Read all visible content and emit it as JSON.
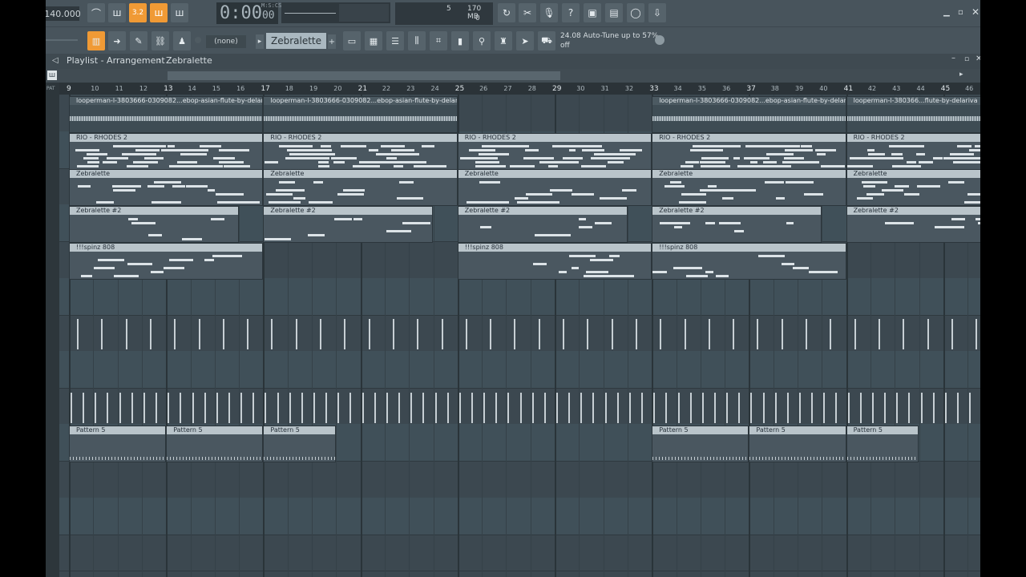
{
  "toolbar": {
    "tempo": "140.000",
    "time_main": "0:00",
    "time_cs": "00",
    "time_unit": "M:S:CS",
    "cpu_value": "5",
    "memory": "170 MB",
    "voices": "0",
    "pattern_mode_label": "3.2"
  },
  "toolbar2": {
    "none_select": "(none)",
    "pattern_select": "Zebralette",
    "hint_version": "24.08",
    "hint_text": "Auto-Tune up to 57% off"
  },
  "playlist": {
    "title": "Playlist - Arrangement",
    "breadcrumb_sep": "›",
    "pattern": "Zebralette",
    "pat_label": "PAT"
  },
  "ruler": {
    "bars": [
      "9",
      "10",
      "11",
      "12",
      "13",
      "14",
      "15",
      "16",
      "17",
      "18",
      "19",
      "20",
      "21",
      "22",
      "23",
      "24",
      "25",
      "26",
      "27",
      "28",
      "29",
      "30",
      "31",
      "32",
      "33",
      "34",
      "35",
      "36",
      "37",
      "38",
      "39",
      "40",
      "41",
      "42",
      "43",
      "44",
      "45",
      "46"
    ]
  },
  "clips": {
    "audio_full": "looperman-l-3803666-0309082...ebop-asian-flute-by-delariva",
    "audio_short": "looperman-l-380366...flute-by-delariva",
    "rhodes": "RIO - RHODES 2",
    "zebra": "Zebralette",
    "zebra2": "Zebralette #2",
    "spinz": "!!!spinz 808",
    "pattern5": "Pattern 5"
  },
  "colors": {
    "accent_orange": "#f09a35",
    "bg": "#3a464e",
    "clip_header": "#b9c4ca",
    "lane_marker": "#8ccf3c"
  }
}
